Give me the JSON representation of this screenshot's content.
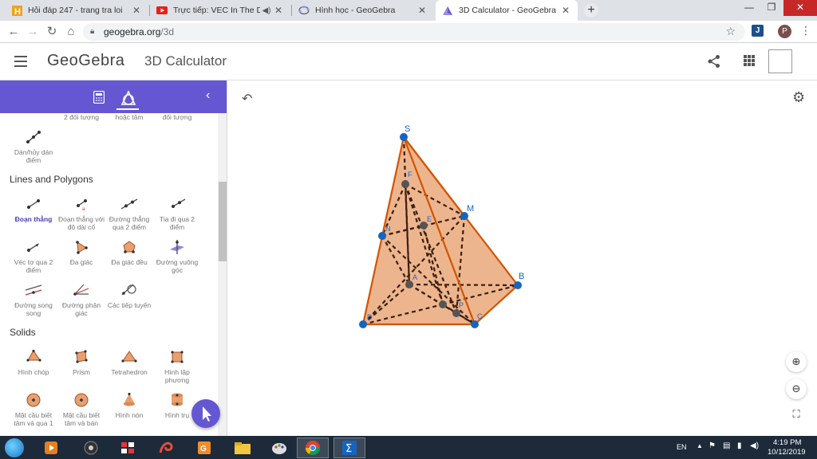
{
  "browser": {
    "tabs": [
      {
        "title": "Hỏi đáp 247 - trang tra loi",
        "icon": "hoidap-favicon",
        "active": false
      },
      {
        "title": "Trực tiếp: VEC In The Dark vs",
        "icon": "youtube-favicon",
        "active": false
      },
      {
        "title": "Hình học - GeoGebra",
        "icon": "geogebra-favicon",
        "active": false
      },
      {
        "title": "3D Calculator - GeoGebra",
        "icon": "geogebra-favicon",
        "active": true
      }
    ],
    "url_host": "geogebra.org",
    "url_path": "/3d",
    "profile_initial": "P",
    "extension_label": "J"
  },
  "header": {
    "logo": "GeoGebra",
    "title": "3D Calculator"
  },
  "sidebar": {
    "top_row": [
      {
        "label": "2 đối tượng"
      },
      {
        "label": "hoặc tâm"
      },
      {
        "label": "đối tượng"
      }
    ],
    "attach_tool": {
      "label": "Dán/hủy dán điểm"
    },
    "sections": [
      {
        "title": "Lines and Polygons",
        "tools": [
          {
            "label": "Đoạn thẳng",
            "selected": true
          },
          {
            "label": "Đoạn thẳng với độ dài cố"
          },
          {
            "label": "Đường thẳng qua 2 điểm"
          },
          {
            "label": "Tia đi qua 2 điểm"
          },
          {
            "label": "Véc tơ qua 2 điểm"
          },
          {
            "label": "Đa giác"
          },
          {
            "label": "Đa giác đều"
          },
          {
            "label": "Đường vuông góc"
          },
          {
            "label": "Đường song song"
          },
          {
            "label": "Đường phân giác"
          },
          {
            "label": "Các tiếp tuyến"
          }
        ]
      },
      {
        "title": "Solids",
        "tools": [
          {
            "label": "Hình chóp"
          },
          {
            "label": "Prism"
          },
          {
            "label": "Tetrahedron"
          },
          {
            "label": "Hình lập phương"
          },
          {
            "label": "Mặt cầu biết tâm và qua 1"
          },
          {
            "label": "Mặt cầu biết tâm và bán"
          },
          {
            "label": "Hình nón"
          },
          {
            "label": "Hình trụ"
          }
        ]
      }
    ]
  },
  "graphics": {
    "points": [
      {
        "name": "S"
      },
      {
        "name": "M"
      },
      {
        "name": "B"
      },
      {
        "name": "C"
      },
      {
        "name": "D"
      },
      {
        "name": "N"
      },
      {
        "name": "A"
      },
      {
        "name": "E"
      },
      {
        "name": "F"
      },
      {
        "name": "P"
      }
    ],
    "colors": {
      "solid_fill": "#e8a06e",
      "edge": "#d35400",
      "hidden_edge": "#3b1f0f",
      "point": "#1565c0",
      "label": "#1565c0"
    }
  },
  "taskbar": {
    "language": "EN",
    "time": "4:19 PM",
    "date": "10/12/2019"
  }
}
